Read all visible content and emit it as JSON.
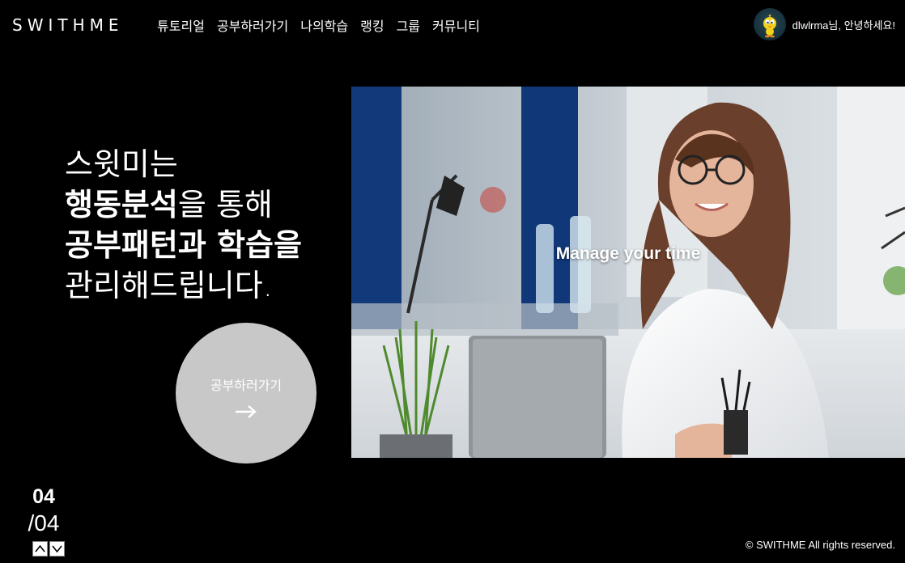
{
  "header": {
    "logo": "SWITHME",
    "nav": [
      "튜토리얼",
      "공부하러가기",
      "나의학습",
      "랭킹",
      "그룹",
      "커뮤니티"
    ],
    "user": {
      "greeting": "dlwlrma님, 안녕하세요!",
      "avatar_icon": "tweety-avatar"
    }
  },
  "hero": {
    "line1": "스윗미는",
    "line2_bold": "행동분석",
    "line2_rest": "을 통해",
    "line3": "공부패턴과 학습을",
    "line4": "관리해드립니다.",
    "cta_label": "공부하러가기",
    "image_caption": "Manage your time"
  },
  "pager": {
    "current": "04",
    "total": "/04"
  },
  "footer": {
    "copyright": "© SWITHME All rights reserved."
  },
  "colors": {
    "background": "#000000",
    "cta": "#c8c8c8",
    "text": "#ffffff"
  }
}
